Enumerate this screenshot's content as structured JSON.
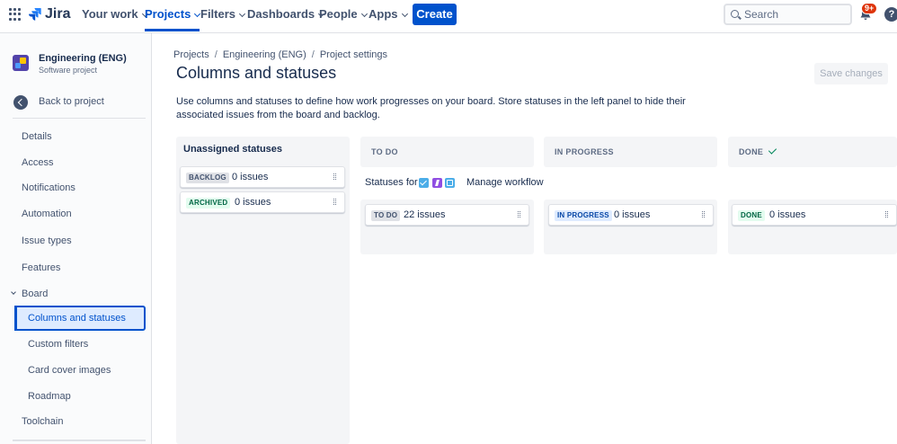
{
  "topnav": {
    "logo_text": "Jira",
    "items": [
      {
        "label": "Your work"
      },
      {
        "label": "Projects"
      },
      {
        "label": "Filters"
      },
      {
        "label": "Dashboards"
      },
      {
        "label": "People"
      },
      {
        "label": "Apps"
      }
    ],
    "create_label": "Create",
    "search_placeholder": "Search",
    "notifications_badge": "9+",
    "help_glyph": "?"
  },
  "sidebar": {
    "project_name": "Engineering (ENG)",
    "project_type": "Software project",
    "back_label": "Back to project",
    "items": [
      {
        "label": "Details"
      },
      {
        "label": "Access"
      },
      {
        "label": "Notifications"
      },
      {
        "label": "Automation"
      },
      {
        "label": "Issue types"
      },
      {
        "label": "Features"
      },
      {
        "label": "Board"
      },
      {
        "label": "Columns and statuses"
      },
      {
        "label": "Custom filters"
      },
      {
        "label": "Card cover images"
      },
      {
        "label": "Roadmap"
      },
      {
        "label": "Toolchain"
      }
    ]
  },
  "breadcrumbs": [
    "Projects",
    "Engineering (ENG)",
    "Project settings"
  ],
  "page_title": "Columns and statuses",
  "save_label": "Save changes",
  "description": "Use columns and statuses to define how work progresses on your board. Store statuses in the left panel to hide their associated issues from the board and backlog.",
  "unassigned": {
    "heading": "Unassigned statuses",
    "statuses": [
      {
        "lozenge": "BACKLOG",
        "count": "0 issues"
      },
      {
        "lozenge": "ARCHIVED",
        "count": "0 issues"
      }
    ]
  },
  "statuses_for_label": "Statuses for",
  "manage_workflow_label": "Manage workflow",
  "columns": [
    {
      "name": "TO DO",
      "status": {
        "lozenge": "TO DO",
        "count": "22 issues"
      }
    },
    {
      "name": "IN PROGRESS",
      "status": {
        "lozenge": "IN PROGRESS",
        "count": "0 issues"
      }
    },
    {
      "name": "DONE",
      "status": {
        "lozenge": "DONE",
        "count": "0 issues"
      }
    }
  ],
  "colors": {
    "brand_blue": "#0052cc",
    "done_green": "#00875a",
    "badge_red": "#de350b"
  }
}
